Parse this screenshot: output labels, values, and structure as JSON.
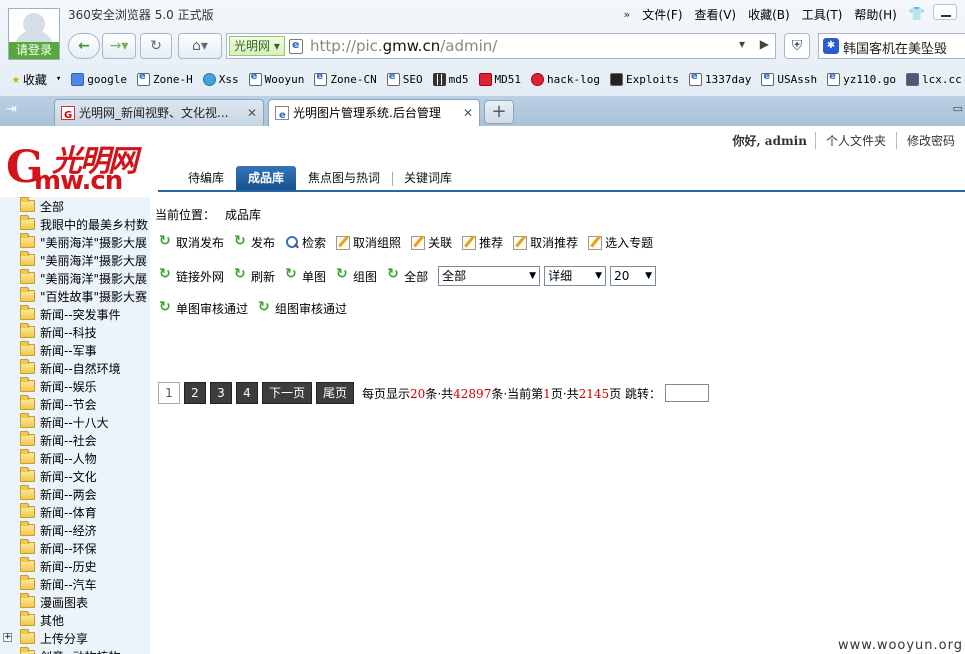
{
  "browser": {
    "login_label": "请登录",
    "window_title": "360安全浏览器 5.0 正式版",
    "menu": [
      "文件(F)",
      "查看(V)",
      "收藏(B)",
      "工具(T)",
      "帮助(H)"
    ],
    "menu_arrows": "»",
    "site_tag": "光明网",
    "url_prefix": "http://pic.",
    "url_domain": "gmw.cn",
    "url_suffix": "/admin/",
    "search_text": "韩国客机在美坠毁"
  },
  "bookmarks": {
    "favorites_label": "收藏",
    "items": [
      {
        "label": "google",
        "icon": "google-icon"
      },
      {
        "label": "Zone-H",
        "icon": "page-icon"
      },
      {
        "label": "Xss",
        "icon": "globe-icon"
      },
      {
        "label": "Wooyun",
        "icon": "page-icon"
      },
      {
        "label": "Zone-CN",
        "icon": "page-icon"
      },
      {
        "label": "SEO",
        "icon": "page-icon"
      },
      {
        "label": "md5",
        "icon": "grid-icon"
      },
      {
        "label": "MD51",
        "icon": "md5-icon"
      },
      {
        "label": "hack-log",
        "icon": "dragon-icon"
      },
      {
        "label": "Exploits",
        "icon": "skull-icon"
      },
      {
        "label": "1337day",
        "icon": "page-icon"
      },
      {
        "label": "USAssh",
        "icon": "page-icon"
      },
      {
        "label": "yz110.go",
        "icon": "page-icon"
      },
      {
        "label": "lcx.cc",
        "icon": "image-icon"
      }
    ]
  },
  "tabs": [
    {
      "label": "光明网_新闻视野、文化视..."
    },
    {
      "label": "光明图片管理系统.后台管理"
    }
  ],
  "header": {
    "greeting": "你好, admin",
    "links": [
      "个人文件夹",
      "修改密码"
    ],
    "nav": [
      {
        "label": "待编库",
        "active": false
      },
      {
        "label": "成品库",
        "active": true
      },
      {
        "label": "焦点图与热词",
        "active": false
      },
      {
        "label": "关键词库",
        "active": false
      }
    ]
  },
  "tree": [
    {
      "label": "全部",
      "expander": false
    },
    {
      "label": "我眼中的最美乡村数",
      "expander": false
    },
    {
      "label": "\"美丽海洋\"摄影大展",
      "expander": false
    },
    {
      "label": "\"美丽海洋\"摄影大展",
      "expander": false
    },
    {
      "label": "\"美丽海洋\"摄影大展",
      "expander": false
    },
    {
      "label": "\"百姓故事\"摄影大赛",
      "expander": false
    },
    {
      "label": "新闻--突发事件",
      "expander": false
    },
    {
      "label": "新闻--科技",
      "expander": false
    },
    {
      "label": "新闻--军事",
      "expander": false
    },
    {
      "label": "新闻--自然环境",
      "expander": false
    },
    {
      "label": "新闻--娱乐",
      "expander": false
    },
    {
      "label": "新闻--节会",
      "expander": false
    },
    {
      "label": "新闻--十八大",
      "expander": false
    },
    {
      "label": "新闻--社会",
      "expander": false
    },
    {
      "label": "新闻--人物",
      "expander": false
    },
    {
      "label": "新闻--文化",
      "expander": false
    },
    {
      "label": "新闻--两会",
      "expander": false
    },
    {
      "label": "新闻--体育",
      "expander": false
    },
    {
      "label": "新闻--经济",
      "expander": false
    },
    {
      "label": "新闻--环保",
      "expander": false
    },
    {
      "label": "新闻--历史",
      "expander": false
    },
    {
      "label": "新闻--汽车",
      "expander": false
    },
    {
      "label": "漫画图表",
      "expander": false
    },
    {
      "label": "其他",
      "expander": false
    },
    {
      "label": "上传分享",
      "expander": true
    },
    {
      "label": "创意--动物植物",
      "expander": false
    }
  ],
  "location": {
    "prefix": "当前位置：",
    "value": "成品库"
  },
  "toolbar": {
    "row1": [
      {
        "label": "取消发布",
        "icon": "recycle-icon"
      },
      {
        "label": "发布",
        "icon": "recycle-icon"
      },
      {
        "label": "检索",
        "icon": "search-icon"
      },
      {
        "label": "取消组照",
        "icon": "edit-icon"
      },
      {
        "label": "关联",
        "icon": "edit-icon"
      },
      {
        "label": "推荐",
        "icon": "edit-icon"
      },
      {
        "label": "取消推荐",
        "icon": "edit-icon"
      },
      {
        "label": "选入专题",
        "icon": "edit-icon"
      }
    ],
    "row2": [
      {
        "label": "链接外网",
        "icon": "recycle-icon"
      },
      {
        "label": "刷新",
        "icon": "recycle-icon"
      },
      {
        "label": "单图",
        "icon": "recycle-icon"
      },
      {
        "label": "组图",
        "icon": "recycle-icon"
      },
      {
        "label": "全部",
        "icon": "recycle-icon"
      }
    ],
    "select_category": "全部",
    "select_view": "详细",
    "select_count": "20",
    "row3": [
      {
        "label": "单图审核通过",
        "icon": "recycle-icon"
      },
      {
        "label": "组图审核通过",
        "icon": "recycle-icon"
      }
    ]
  },
  "pager": {
    "pages": [
      "1",
      "2",
      "3",
      "4"
    ],
    "current": "1",
    "next": "下一页",
    "last": "尾页",
    "info_per_page_prefix": "每页显示",
    "per_page": "20",
    "info_total_prefix": "条·共",
    "total": "42897",
    "info_current_prefix": "条·当前第",
    "current_page": "1",
    "info_pages_prefix": "页·共",
    "total_pages": "2145",
    "info_suffix": "页 跳转："
  },
  "watermark": "www.wooyun.org",
  "colors": {
    "accent": "#1c5796",
    "brand_red": "#d3131a",
    "tree_bg": "#ecf4fb",
    "icon_green": "#3aa130"
  }
}
